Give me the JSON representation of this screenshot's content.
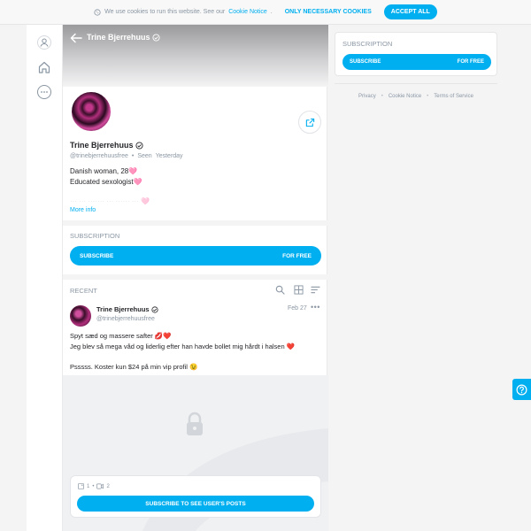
{
  "cookie": {
    "message": "We use cookies to run this website. See our",
    "link": "Cookie Notice",
    "dot": ".",
    "necessary_label": "ONLY NECESSARY COOKIES",
    "accept_label": "ACCEPT ALL"
  },
  "nav": {
    "items": [
      "avatar-icon",
      "home-icon",
      "more-icon"
    ]
  },
  "profile": {
    "cover_title": "Trine Bjerrehuus",
    "name": "Trine Bjerrehuus",
    "handle": "@trinebjerrehuusfree",
    "separator": "•",
    "seen": "Seen",
    "seen_when": "Yesterday",
    "bio_line1": "Danish woman, 28🩷",
    "bio_line2": "Educated sexologist🩷",
    "bio_faded": "··· ··· ······· ··· ······ ··· 🩷",
    "more_info": "More info"
  },
  "subscription": {
    "title": "SUBSCRIPTION",
    "button_label": "SUBSCRIBE",
    "price_label": "FOR FREE"
  },
  "recent": {
    "title": "RECENT"
  },
  "post": {
    "author": "Trine Bjerrehuus",
    "handle": "@trinebjerrehuusfree",
    "date": "Feb 27",
    "more": "•••",
    "line1": "Spyt sæd og massere safter 💋❤️",
    "line2": "Jeg blev så mega våd og liderlig efter han havde bollet mig hårdt i halsen ❤️",
    "line3": "Psssss. Koster kun $24 på min vip profil 😉",
    "photo_count": "1",
    "video_count": "2",
    "count_sep": "•",
    "locked_button": "SUBSCRIBE TO SEE USER'S POSTS"
  },
  "sidebar": {
    "subscription_title": "SUBSCRIPTION",
    "button_label": "SUBSCRIBE",
    "price_label": "FOR FREE"
  },
  "footer": {
    "privacy": "Privacy",
    "cookie_notice": "Cookie Notice",
    "terms": "Terms of Service",
    "dot": "•"
  },
  "colors": {
    "accent": "#00aff0",
    "muted": "#8a96a3",
    "background": "#f4f4f5"
  }
}
